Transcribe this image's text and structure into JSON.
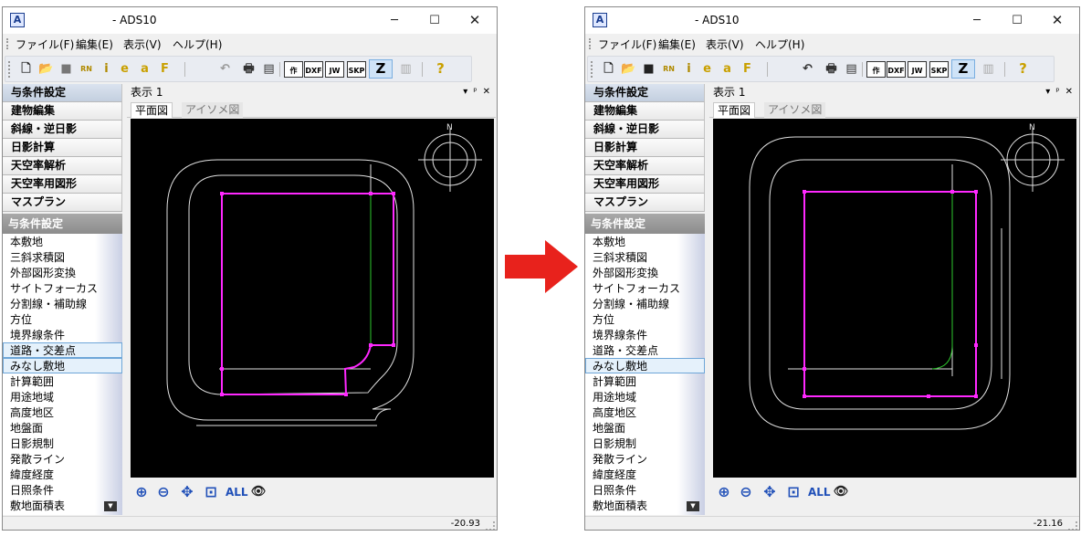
{
  "window": {
    "title": "- ADS10",
    "icon": "app-icon",
    "controls": {
      "minimize": "─",
      "maximize": "☐",
      "close": "✕"
    }
  },
  "menu": [
    "ファイル(F)",
    "編集(E)",
    "表示(V)",
    "ヘルプ(H)"
  ],
  "toolbar": {
    "buttons_left": [
      {
        "name": "new-file-icon",
        "glyph": "🗋"
      },
      {
        "name": "open-folder-icon",
        "glyph": "📂"
      },
      {
        "name": "save-icon",
        "glyph": "■"
      },
      {
        "name": "rn-icon",
        "glyph": "RN"
      },
      {
        "name": "info-icon",
        "glyph": "i"
      },
      {
        "name": "e-icon",
        "glyph": "e"
      },
      {
        "name": "a-icon",
        "glyph": "a"
      },
      {
        "name": "f-icon",
        "glyph": "F"
      }
    ],
    "buttons_right": [
      {
        "name": "undo-icon",
        "glyph": "↶"
      },
      {
        "name": "print-icon",
        "glyph": "🖶"
      },
      {
        "name": "layout-icon",
        "glyph": "▤"
      }
    ],
    "text_buttons": [
      "作",
      "DXF",
      "JW",
      "SKP"
    ],
    "z_button": "Z",
    "book_icon": "▥",
    "help_icon": "?"
  },
  "categories": [
    "与条件設定",
    "建物編集",
    "斜線・逆日影",
    "日影計算",
    "天空率解析",
    "天空率用図形",
    "マスプラン"
  ],
  "section_header": "与条件設定",
  "sub_items": [
    "本敷地",
    "三斜求積図",
    "外部図形変換",
    "サイトフォーカス",
    "分割線・補助線",
    "方位",
    "境界線条件",
    "道路・交差点",
    "みなし敷地",
    "計算範囲",
    "用途地域",
    "高度地区",
    "地盤面",
    "日影規制",
    "発散ライン",
    "緯度経度",
    "日照条件",
    "敷地面積表"
  ],
  "doc": {
    "title": "表示 1",
    "controls": [
      "▾",
      "ᵖ",
      "✕"
    ],
    "tabs": [
      "平面図",
      "アイソメ図"
    ]
  },
  "zoom_tools": [
    {
      "name": "zoom-in-icon",
      "glyph": "⊕"
    },
    {
      "name": "zoom-out-icon",
      "glyph": "⊖"
    },
    {
      "name": "pan-icon",
      "glyph": "✥"
    },
    {
      "name": "zoom-window-icon",
      "glyph": "⊡"
    },
    {
      "name": "zoom-all-label",
      "glyph": "ALL"
    },
    {
      "name": "eye-icon",
      "glyph": "👁"
    }
  ],
  "panels": [
    {
      "id": "before",
      "status": "-20.93",
      "highlighted_items": [
        "道路・交差点",
        "みなし敷地"
      ]
    },
    {
      "id": "after",
      "status": "-21.16",
      "highlighted_items": [
        "みなし敷地"
      ]
    }
  ],
  "colors": {
    "magenta": "#ff28ff",
    "green": "#2ec92e",
    "white": "#e0e0e0",
    "arrow": "#e8221c",
    "z_active_bg": "#cfe3f7"
  }
}
